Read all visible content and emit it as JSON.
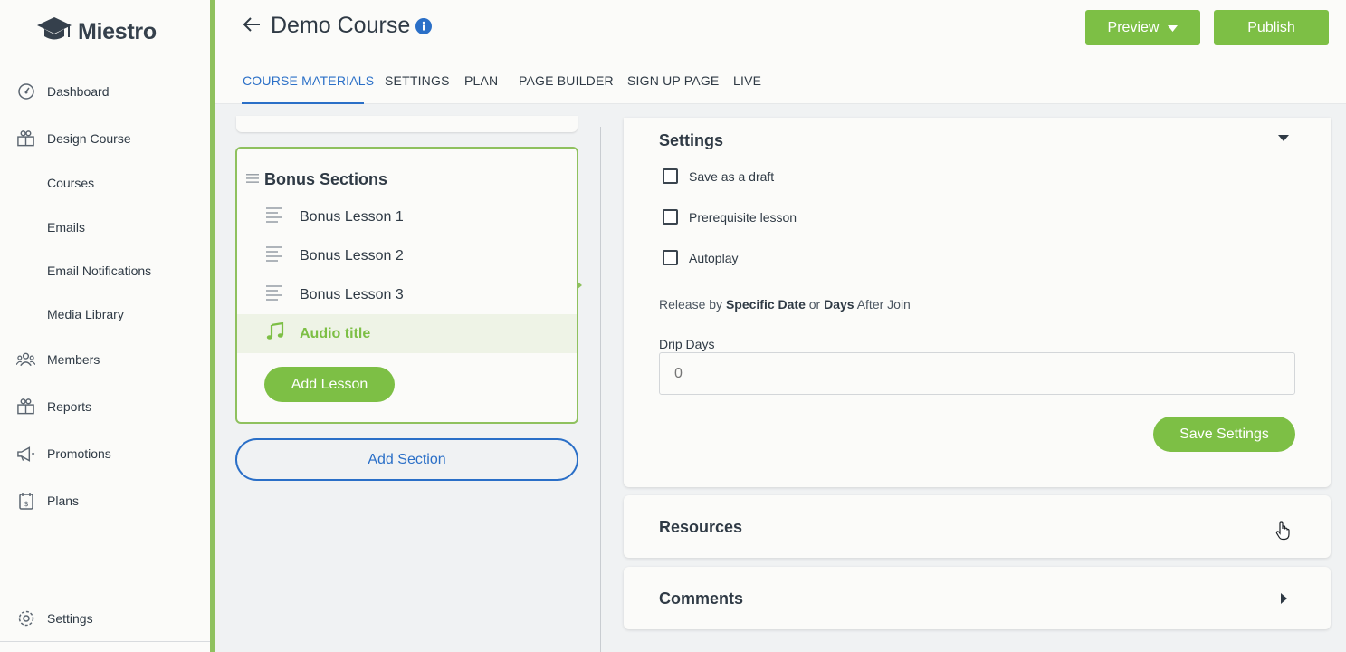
{
  "app": {
    "logo_text": "Miestro"
  },
  "sidebar": {
    "items": [
      {
        "label": "Dashboard",
        "icon": "dashboard-gauge-icon"
      },
      {
        "label": "Design Course",
        "icon": "design-course-icon"
      },
      {
        "label": "Members",
        "icon": "members-icon"
      },
      {
        "label": "Reports",
        "icon": "reports-icon"
      },
      {
        "label": "Promotions",
        "icon": "megaphone-icon"
      },
      {
        "label": "Plans",
        "icon": "plans-icon"
      }
    ],
    "sub_items": [
      "Courses",
      "Emails",
      "Email Notifications",
      "Media Library"
    ],
    "settings_label": "Settings"
  },
  "header": {
    "title": "Demo Course",
    "preview_label": "Preview",
    "publish_label": "Publish",
    "tabs": [
      "COURSE MATERIALS",
      "SETTINGS",
      "PLAN",
      "PAGE BUILDER",
      "SIGN UP PAGE",
      "LIVE"
    ],
    "active_tab": "COURSE MATERIALS"
  },
  "section": {
    "title": "Bonus Sections",
    "lessons": [
      {
        "label": "Bonus Lesson 1",
        "icon": "text-lines-icon"
      },
      {
        "label": "Bonus Lesson 2",
        "icon": "text-lines-icon"
      },
      {
        "label": "Bonus Lesson 3",
        "icon": "text-lines-icon"
      },
      {
        "label": "Audio title",
        "icon": "music-note-icon",
        "active": true
      }
    ],
    "add_lesson_label": "Add Lesson",
    "add_section_label": "Add Section"
  },
  "settings_panel": {
    "title": "Settings",
    "checkboxes": [
      {
        "label": "Save as a draft",
        "checked": false
      },
      {
        "label": "Prerequisite lesson",
        "checked": false
      },
      {
        "label": "Autoplay",
        "checked": false
      }
    ],
    "release_prefix": "Release by",
    "release_specific": "Specific Date",
    "release_or": "or",
    "release_days": "Days",
    "release_suffix": "After Join",
    "drip_label": "Drip Days",
    "drip_placeholder": "0",
    "save_label": "Save Settings"
  },
  "resources": {
    "title": "Resources"
  },
  "comments": {
    "title": "Comments"
  },
  "colors": {
    "accent_green": "#7dbf45",
    "link_blue": "#2a6fc7",
    "sidebar_border": "#8fc15e"
  }
}
